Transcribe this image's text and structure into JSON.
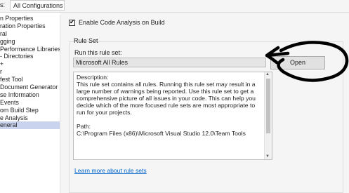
{
  "configuration": {
    "label": "s:",
    "value": "All Configurations"
  },
  "nav": {
    "items": [
      "n Properties",
      "ration Properties",
      "ral",
      "gging",
      "Performance Libraries",
      "- Directories",
      "+",
      "r",
      "fest Tool",
      "Document Generator",
      "se Information",
      "Events",
      "om Build Step",
      "e Analysis",
      "eneral"
    ],
    "selected_index": 14
  },
  "main": {
    "enable_checkbox": {
      "label": "Enable Code Analysis on Build",
      "checked": true
    },
    "rule_set": {
      "title": "Rule Set",
      "run_label": "Run this rule set:",
      "selected": "Microsoft All Rules",
      "open_button": "Open",
      "description_label": "Description:",
      "description_text": "This rule set contains all rules. Running this rule set may result in a large number of warnings being reported. Use this rule set to get a comprehensive picture of all issues in your code. This can help you decide which of the more focused rule sets are most appropriate to run for your projects.",
      "path_label": "Path:",
      "path_value": "C:\\Program Files (x86)\\Microsoft Visual Studio 12.0\\Team Tools"
    },
    "learn_more_link": "Learn more about rule sets"
  },
  "colors": {
    "selection": "#c9d3ee",
    "link": "#0066cc",
    "pane_bg": "#f5f5f5"
  }
}
